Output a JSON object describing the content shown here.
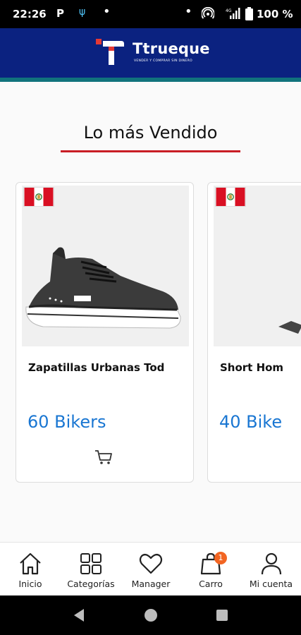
{
  "status_bar": {
    "time": "22:26",
    "p_icon": "P",
    "usb_icon": "usb-icon",
    "battery": "100 %"
  },
  "header": {
    "brand": "Ttrueque",
    "tagline": "VENDER Y COMPRAR SIN DINERO",
    "brand_color": "#0b2280",
    "accent_color": "#11737c"
  },
  "section": {
    "title": "Lo más Vendido",
    "underline_color": "#c81d25"
  },
  "products": [
    {
      "name": "Zapatillas Urbanas Tod",
      "price": "60 Bikers",
      "flag": "peru-flag-icon",
      "image": "sneaker-image"
    },
    {
      "name": "Short Hom",
      "price": "40 Bike",
      "flag": "peru-flag-icon",
      "image": "shorts-image"
    }
  ],
  "bottom_nav": {
    "items": [
      {
        "label": "Inicio",
        "icon": "home-icon"
      },
      {
        "label": "Categorías",
        "icon": "grid-icon"
      },
      {
        "label": "Manager",
        "icon": "heart-icon"
      },
      {
        "label": "Carro",
        "icon": "bag-icon",
        "badge": "1"
      },
      {
        "label": "Mi cuenta",
        "icon": "user-icon"
      }
    ]
  },
  "price_color": "#1976d2"
}
